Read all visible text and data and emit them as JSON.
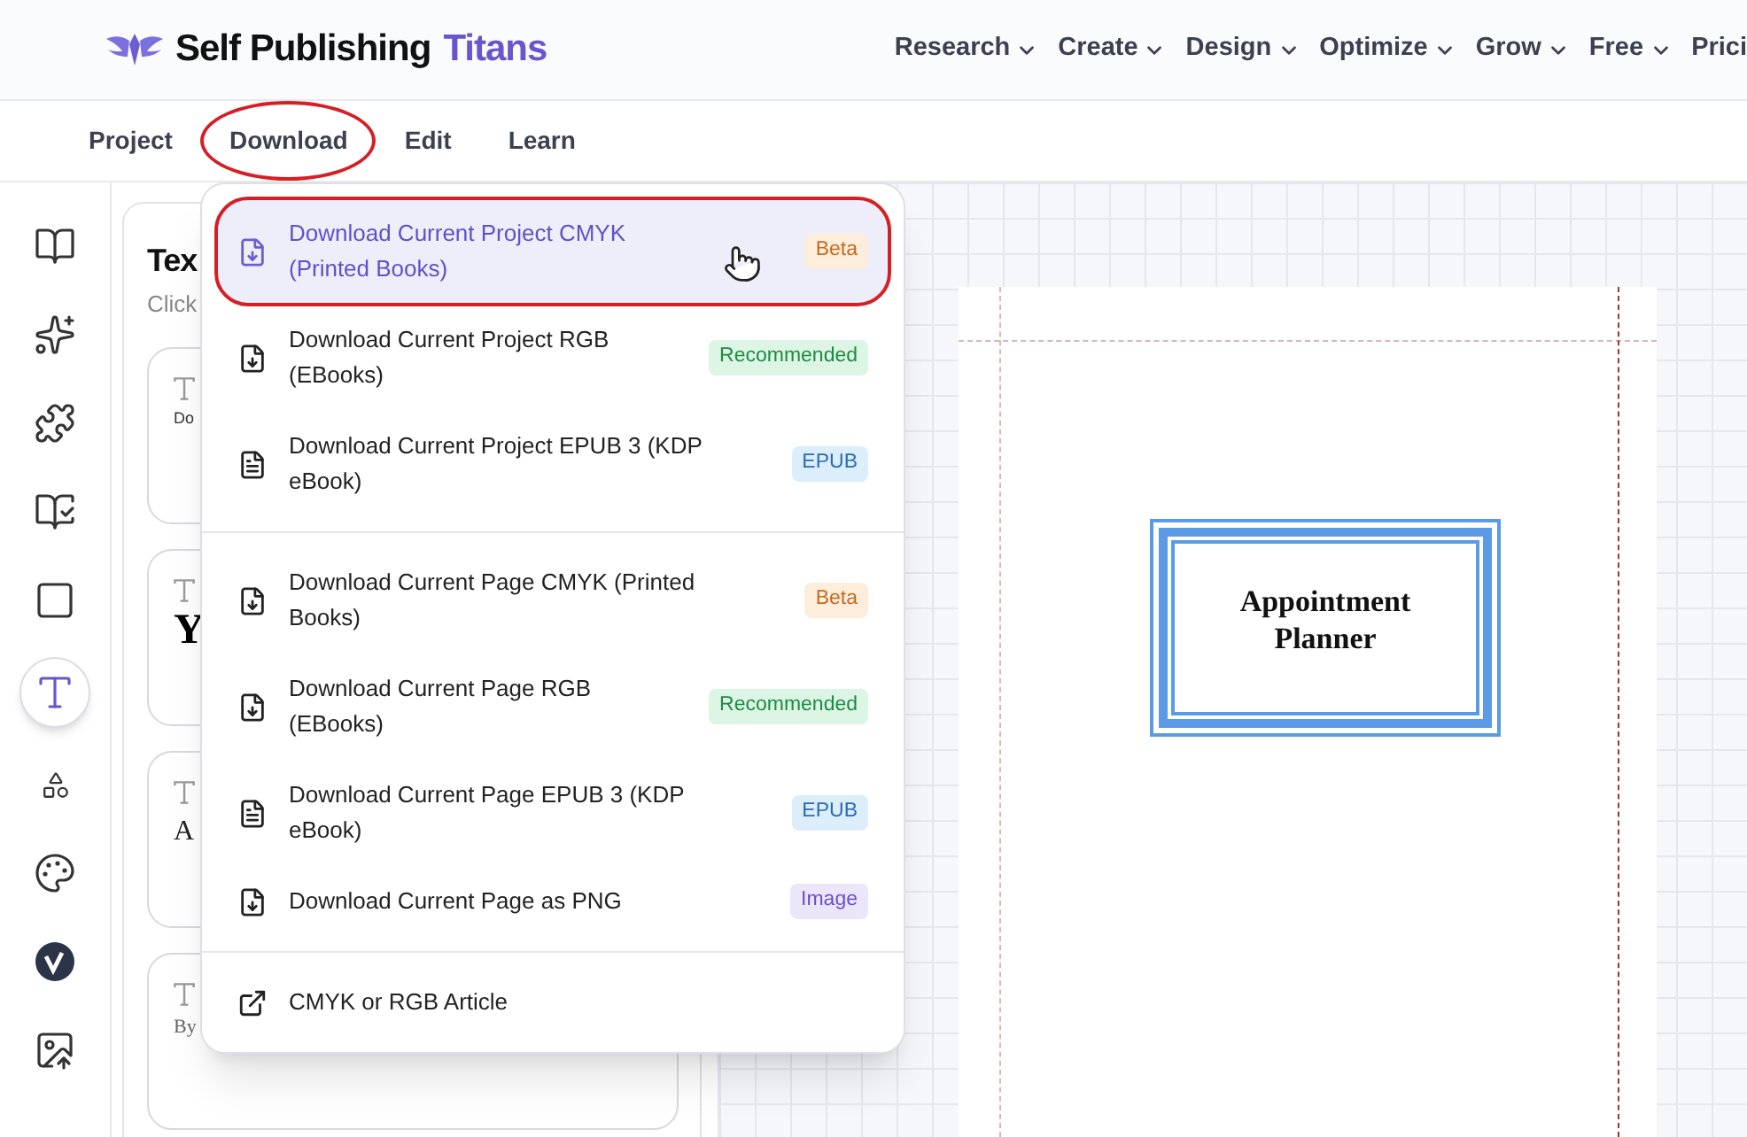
{
  "header": {
    "brand": "Self Publishing",
    "brand_accent": "Titans",
    "nav": [
      {
        "label": "Research",
        "has_menu": true
      },
      {
        "label": "Create",
        "has_menu": true
      },
      {
        "label": "Design",
        "has_menu": true
      },
      {
        "label": "Optimize",
        "has_menu": true
      },
      {
        "label": "Grow",
        "has_menu": true
      },
      {
        "label": "Free",
        "has_menu": true
      },
      {
        "label": "Prici",
        "has_menu": false
      }
    ]
  },
  "toolbar": {
    "tabs": [
      {
        "label": "Project",
        "circled": false
      },
      {
        "label": "Download",
        "circled": true
      },
      {
        "label": "Edit",
        "circled": false
      },
      {
        "label": "Learn",
        "circled": false
      }
    ]
  },
  "sidebar": {
    "items": [
      {
        "selected": false
      },
      {
        "selected": false
      },
      {
        "selected": false
      },
      {
        "selected": false
      },
      {
        "selected": false
      },
      {
        "selected": true
      },
      {
        "selected": false
      },
      {
        "selected": false
      },
      {
        "selected": false
      },
      {
        "selected": false
      }
    ]
  },
  "panel": {
    "title": "Tex",
    "subtitle": "Click",
    "cards": [
      {
        "kind": "small",
        "text": "Do"
      },
      {
        "kind": "heading",
        "text": "Y"
      },
      {
        "kind": "body",
        "text": "A"
      },
      {
        "kind": "byline",
        "text": "By"
      }
    ]
  },
  "canvas": {
    "page": {
      "title": "Appointment Planner"
    }
  },
  "download_menu": {
    "groups": [
      {
        "items": [
          {
            "kind": "download",
            "label": "Download Current Project CMYK (Printed Books)",
            "badge": {
              "text": "Beta",
              "kind": "beta"
            },
            "selected": true,
            "circled": true
          },
          {
            "kind": "download",
            "label": "Download Current Project RGB (EBooks)",
            "badge": {
              "text": "Recommended",
              "kind": "recommended"
            },
            "selected": false,
            "circled": false
          },
          {
            "kind": "document",
            "label": "Download Current Project EPUB 3 (KDP eBook)",
            "badge": {
              "text": "EPUB",
              "kind": "epub"
            },
            "selected": false,
            "circled": false
          }
        ]
      },
      {
        "items": [
          {
            "kind": "download",
            "label": "Download Current Page CMYK (Printed Books)",
            "badge": {
              "text": "Beta",
              "kind": "beta"
            },
            "selected": false,
            "circled": false
          },
          {
            "kind": "download",
            "label": "Download Current Page RGB (EBooks)",
            "badge": {
              "text": "Recommended",
              "kind": "recommended"
            },
            "selected": false,
            "circled": false
          },
          {
            "kind": "document",
            "label": "Download Current Page EPUB 3 (KDP eBook)",
            "badge": {
              "text": "EPUB",
              "kind": "epub"
            },
            "selected": false,
            "circled": false
          },
          {
            "kind": "download",
            "label": "Download Current Page as PNG",
            "badge": {
              "text": "Image",
              "kind": "image"
            },
            "selected": false,
            "circled": false
          }
        ]
      },
      {
        "items": [
          {
            "kind": "link",
            "label": "CMYK or RGB Article",
            "selected": false,
            "circled": false
          }
        ]
      }
    ]
  }
}
